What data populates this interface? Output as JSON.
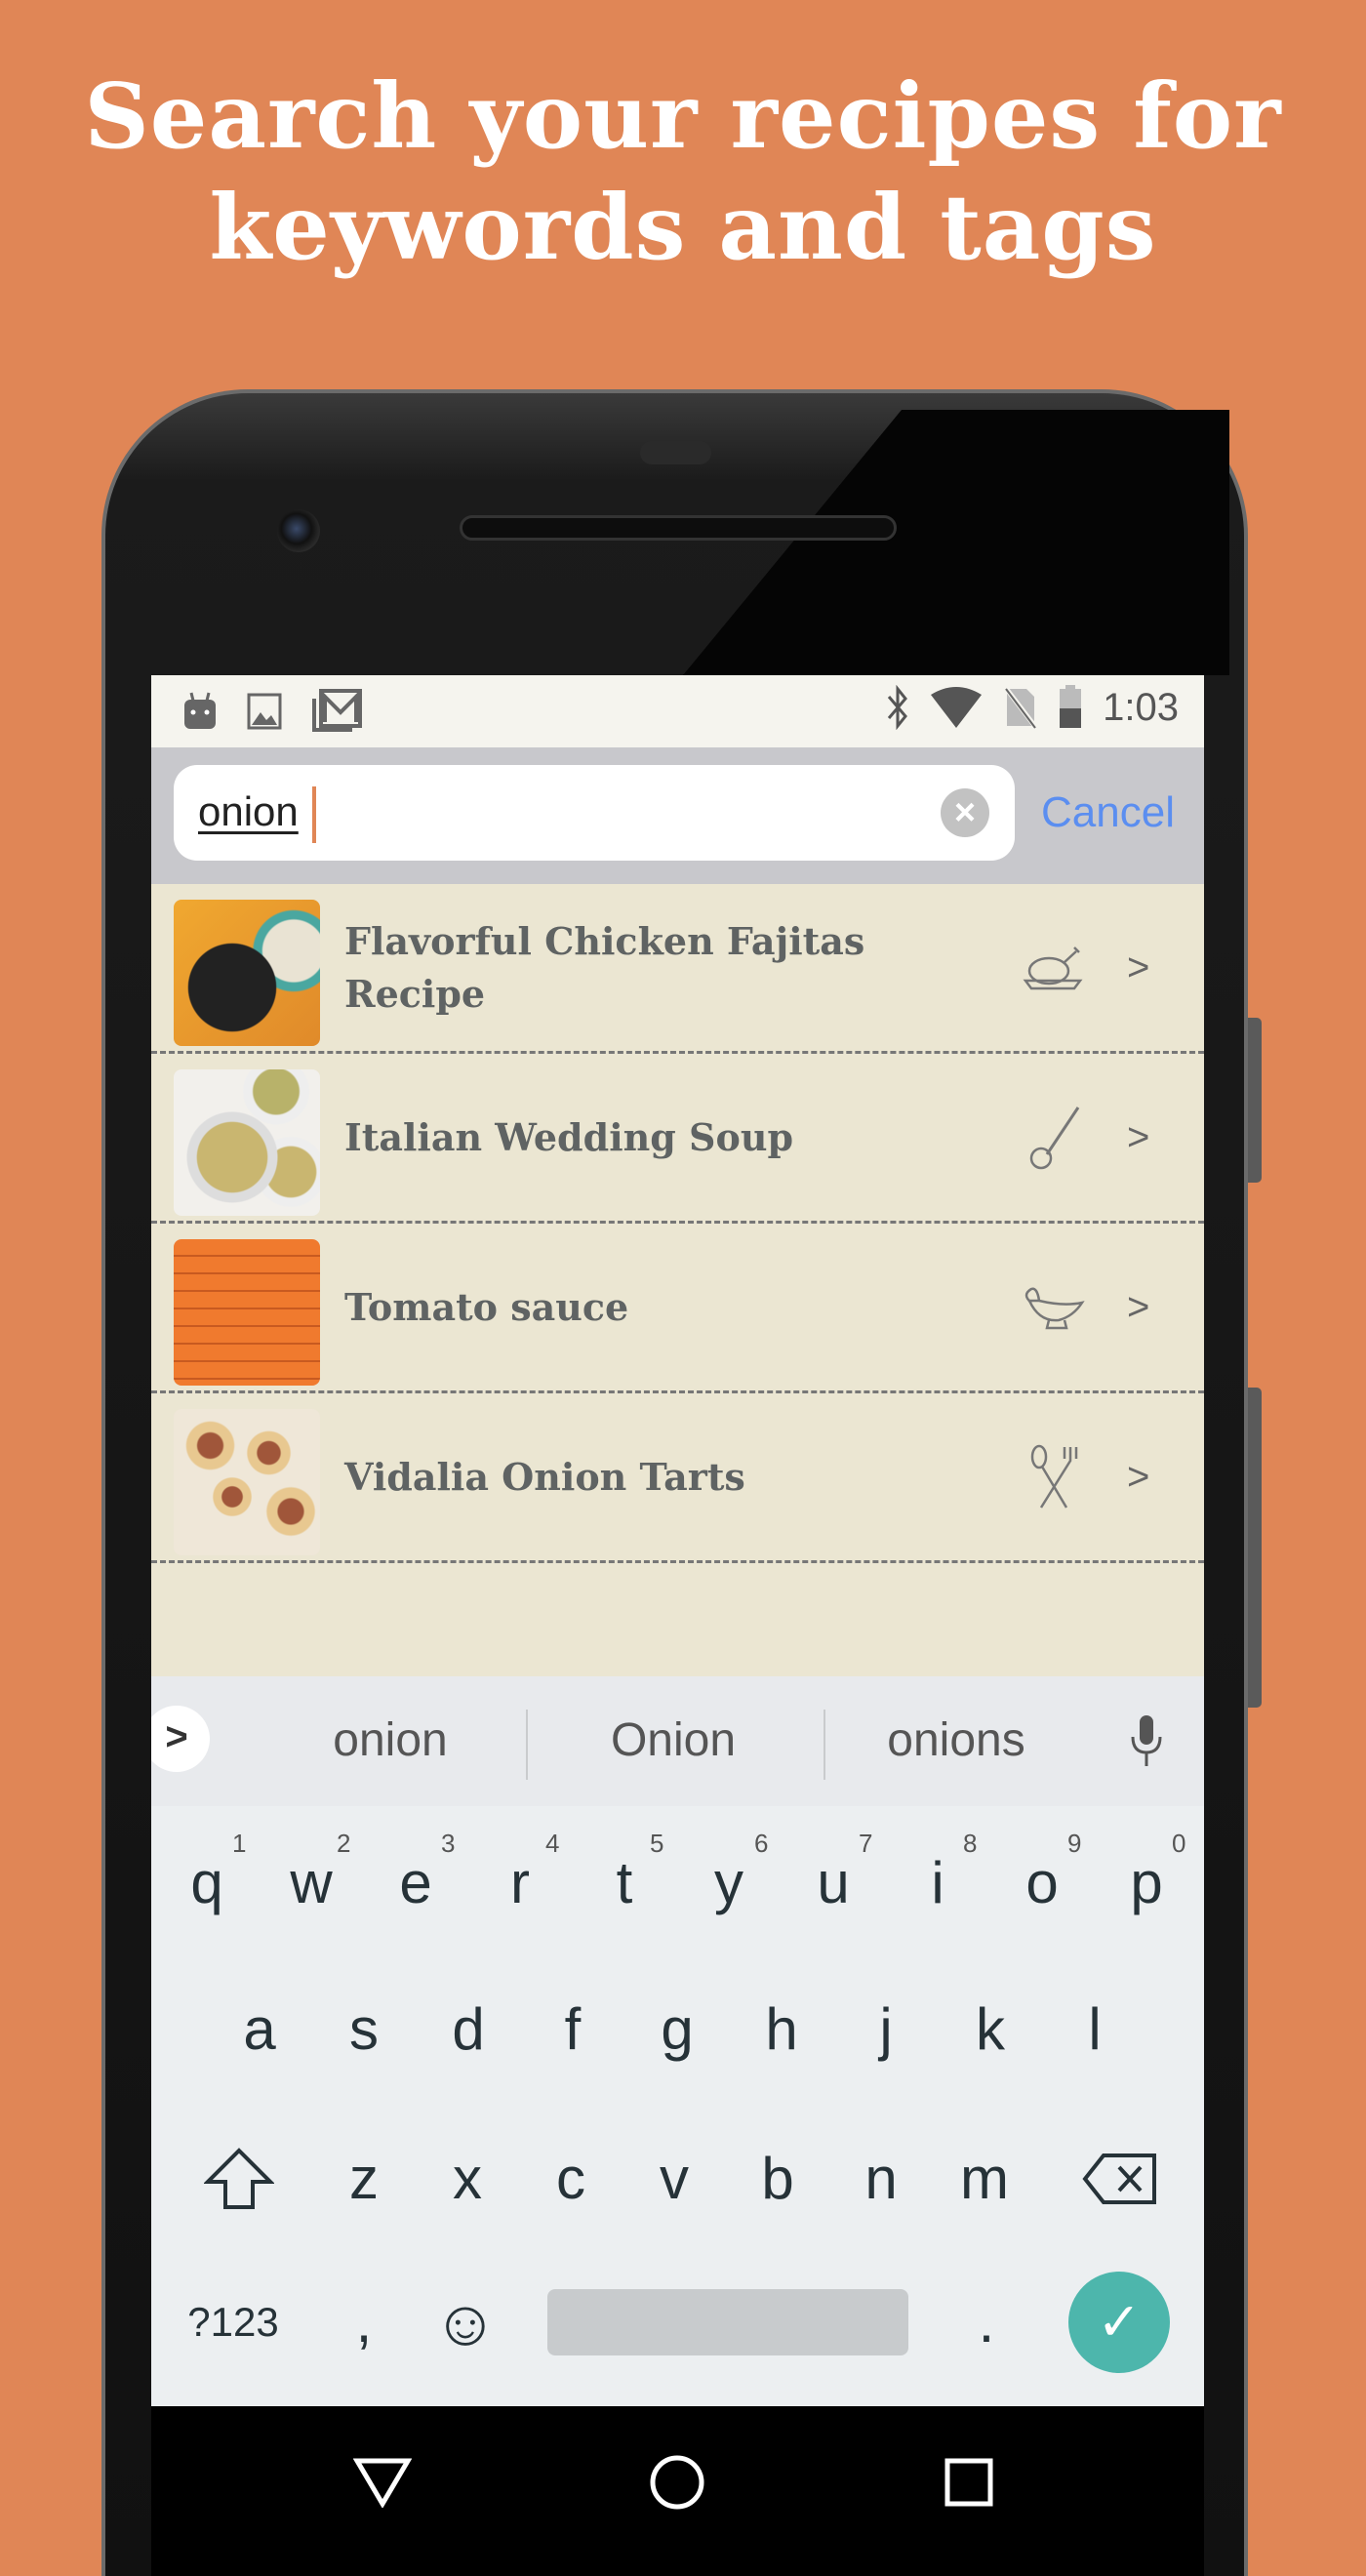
{
  "headline": {
    "line1": "Search your recipes for",
    "line2": "keywords and tags"
  },
  "status_bar": {
    "left_icons": [
      "android-icon",
      "image-icon",
      "gmail-icon"
    ],
    "right_icons": [
      "bluetooth-icon",
      "wifi-icon",
      "no-sim-icon",
      "battery-icon"
    ],
    "battery_level": 0.5,
    "time": "1:03"
  },
  "search": {
    "value": "onion",
    "clear_icon": "clear-icon",
    "cancel_label": "Cancel"
  },
  "recipes": [
    {
      "title": "Flavorful Chicken Fajitas Recipe",
      "category_icon": "roast-chicken-icon"
    },
    {
      "title": "Italian Wedding Soup",
      "category_icon": "ladle-icon"
    },
    {
      "title": "Tomato sauce",
      "category_icon": "gravy-boat-icon"
    },
    {
      "title": "Vidalia Onion Tarts",
      "category_icon": "spoon-fork-icon"
    }
  ],
  "chevron": ">",
  "keyboard": {
    "suggestions": [
      "onion",
      "Onion",
      "onions"
    ],
    "row1": [
      "q",
      "w",
      "e",
      "r",
      "t",
      "y",
      "u",
      "i",
      "o",
      "p"
    ],
    "row1_hints": [
      "1",
      "2",
      "3",
      "4",
      "5",
      "6",
      "7",
      "8",
      "9",
      "0"
    ],
    "row2": [
      "a",
      "s",
      "d",
      "f",
      "g",
      "h",
      "j",
      "k",
      "l"
    ],
    "row3": [
      "z",
      "x",
      "c",
      "v",
      "b",
      "n",
      "m"
    ],
    "symbols_label": "?123",
    "comma": ",",
    "period": ".",
    "emoji": "☺",
    "enter": "✓",
    "expand": ">"
  },
  "colors": {
    "background": "#e08656",
    "accent": "#5b8ef0",
    "enter": "#4db6ac",
    "list_bg": "#ebe6d2"
  }
}
